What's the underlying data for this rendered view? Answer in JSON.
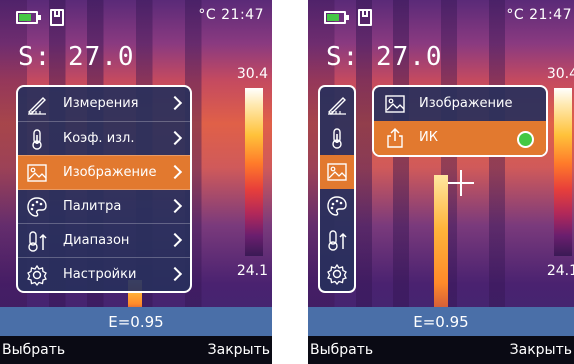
{
  "left": {
    "status": {
      "unit_time": "°C 21:47"
    },
    "spot_temp": "S: 27.0",
    "scale": {
      "max": "30.4",
      "min": "24.1"
    },
    "emissivity": "E=0.95",
    "menu": {
      "items": [
        {
          "label": "Измерения",
          "icon": "measure-icon"
        },
        {
          "label": "Коэф. изл.",
          "icon": "thermometer-icon"
        },
        {
          "label": "Изображение",
          "icon": "image-icon",
          "selected": true
        },
        {
          "label": "Палитра",
          "icon": "palette-icon"
        },
        {
          "label": "Диапазон",
          "icon": "range-icon"
        },
        {
          "label": "Настройки",
          "icon": "gear-icon"
        }
      ]
    },
    "softkeys": {
      "left": "Выбрать",
      "right": "Закрыть"
    }
  },
  "right": {
    "status": {
      "unit_time": "°C 21:47"
    },
    "spot_temp": "S: 27.0",
    "scale": {
      "max": "30.4",
      "min": "24.1"
    },
    "emissivity": "E=0.95",
    "submenu": {
      "items": [
        {
          "label": "Изображение",
          "icon": "image-icon"
        },
        {
          "label": "ИК",
          "icon": "share-icon",
          "selected": true
        }
      ]
    },
    "softkeys": {
      "left": "Выбрать",
      "right": "Закрыть"
    }
  },
  "colors": {
    "accent": "#e2792f",
    "menu_bg": "#28305c",
    "battery": "#46c846",
    "emissivity_bar": "#4a6fa8"
  }
}
